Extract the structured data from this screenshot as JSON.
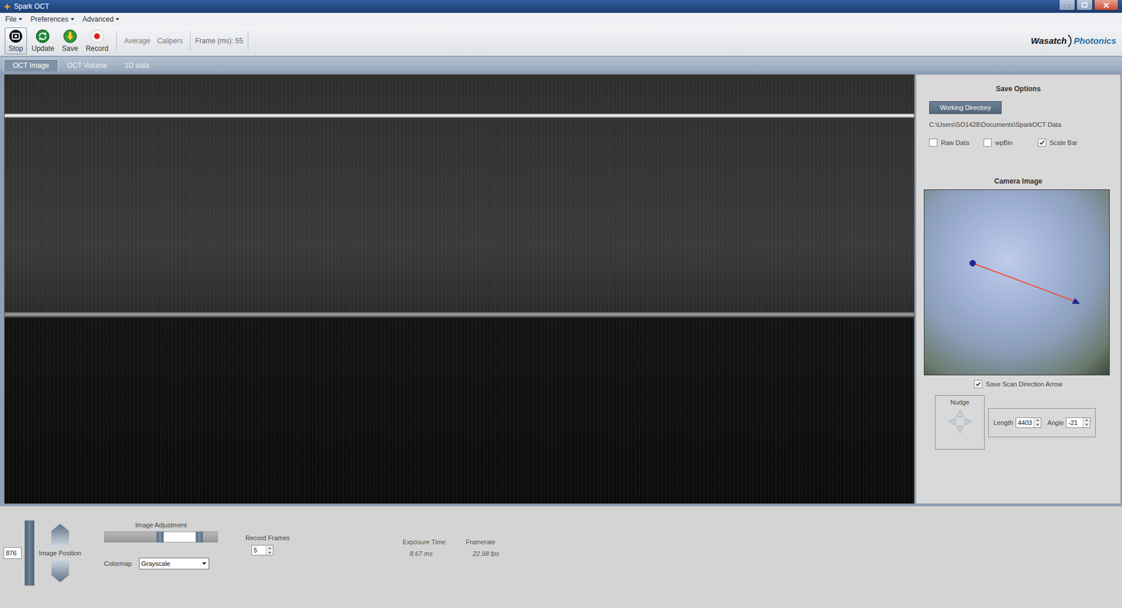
{
  "window": {
    "title": "Spark OCT"
  },
  "menu": [
    {
      "label": "File"
    },
    {
      "label": "Preferences"
    },
    {
      "label": "Advanced"
    }
  ],
  "toolbar": {
    "buttons": [
      {
        "label": "Stop",
        "selected": true
      },
      {
        "label": "Update",
        "selected": false
      },
      {
        "label": "Save",
        "selected": false
      },
      {
        "label": "Record",
        "selected": false
      }
    ],
    "tools": [
      {
        "label": "Average",
        "disabled": true
      },
      {
        "label": "Calipers",
        "disabled": true
      }
    ],
    "frame": "Frame (ms): 55"
  },
  "logo": {
    "first": "Wasatch",
    "second": "Photonics"
  },
  "tabs": [
    {
      "label": "OCT Image",
      "selected": true
    },
    {
      "label": "OCT Volume",
      "selected": false
    },
    {
      "label": "1D data",
      "selected": false
    }
  ],
  "save_options": {
    "title": "Save Options",
    "button": "Working Directory",
    "path": "C:\\Users\\SO1428\\Documents\\SparkOCT Data",
    "checkboxes": [
      {
        "label": "Raw Data",
        "checked": false
      },
      {
        "label": "wpBin",
        "checked": false
      },
      {
        "label": "Scale Bar",
        "checked": true
      }
    ]
  },
  "camera": {
    "title": "Camera Image",
    "arrow_option": {
      "label": "Save Scan Direction Arrow",
      "checked": true
    }
  },
  "nudge": {
    "title": "Nudge"
  },
  "scan": [
    {
      "label": "Length",
      "value": "4403"
    },
    {
      "label": "Angle",
      "value": "-21"
    }
  ],
  "image_position": {
    "value": "876",
    "level": 1,
    "label": "Image Position"
  },
  "image_adjustment": {
    "title": "Image Adjustment",
    "level_low": 0.49,
    "level_high": 0.84
  },
  "colormap": {
    "label": "Colormap",
    "value": "Grayscale"
  },
  "record_frames": {
    "label": "Record Frames",
    "value": "5"
  },
  "stats": [
    {
      "label": "Exposure Time",
      "value": "8.67 ms"
    },
    {
      "label": "Framerate",
      "value": "22.98 fps"
    }
  ]
}
